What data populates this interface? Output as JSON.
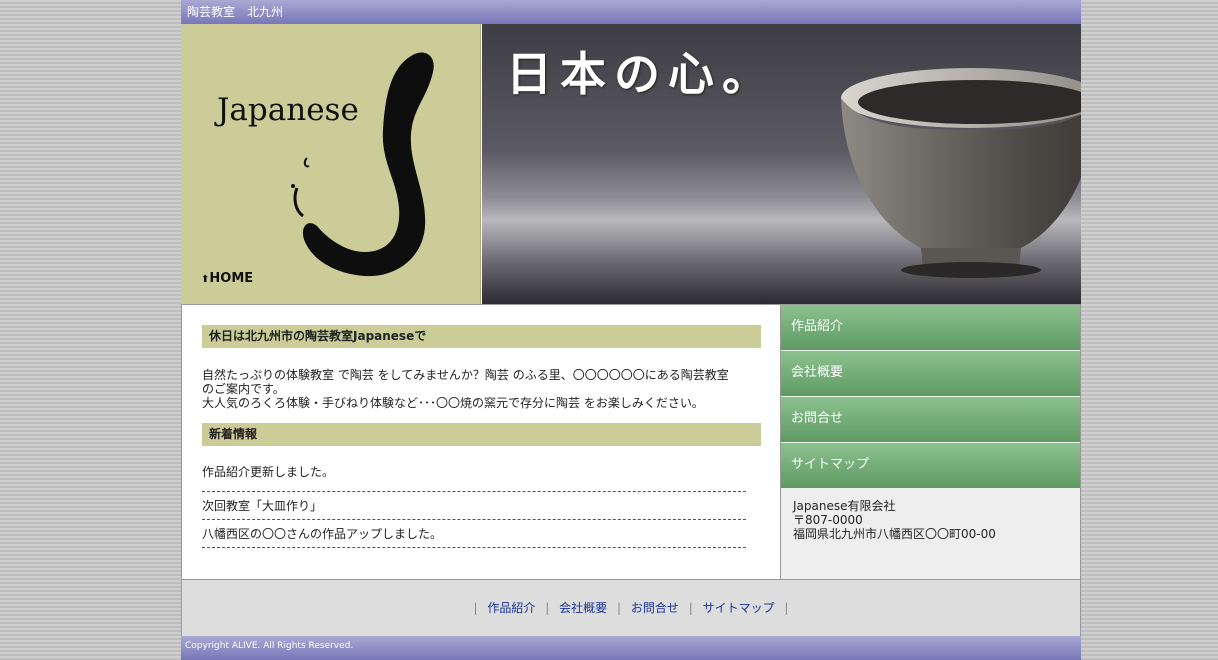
{
  "topbar": {
    "title": "陶芸教室　北九州"
  },
  "header": {
    "brand": "Japanese",
    "home_label": "HOME",
    "hero_copy": "日本の心。"
  },
  "content": {
    "section1_title": "休日は北九州市の陶芸教室Japaneseで",
    "intro_line1": "自然たっぷりの体験教室 で陶芸 をしてみませんか？陶芸 のふる里、〇〇〇〇〇〇にある陶芸教室",
    "intro_line2": "のご案内です。",
    "intro_line3": "大人気のろくろ体験・手びねり体験など･･･〇〇焼の窯元で存分に陶芸 をお楽しみください。",
    "section2_title": "新着情報",
    "news": [
      "作品紹介更新しました。",
      "次回教室「大皿作り」",
      "八幡西区の〇〇さんの作品アップしました。"
    ]
  },
  "sidebar": {
    "nav": [
      "作品紹介",
      "会社概要",
      "お問合せ",
      "サイトマップ"
    ],
    "company_name": "Japanese有限会社",
    "postal": "〒807-0000",
    "address": "福岡県北九州市八幡西区〇〇町00-00"
  },
  "footer": {
    "links": [
      "作品紹介",
      "会社概要",
      "お問合せ",
      "サイトマップ"
    ],
    "separator": "|",
    "copyright": "Copyright ALIVE. All Rights Reserved."
  },
  "colors": {
    "bar_purple": "#8a8ac6",
    "khaki": "#cccc99",
    "nav_green": "#7bb07e",
    "link_blue": "#1a3399"
  }
}
